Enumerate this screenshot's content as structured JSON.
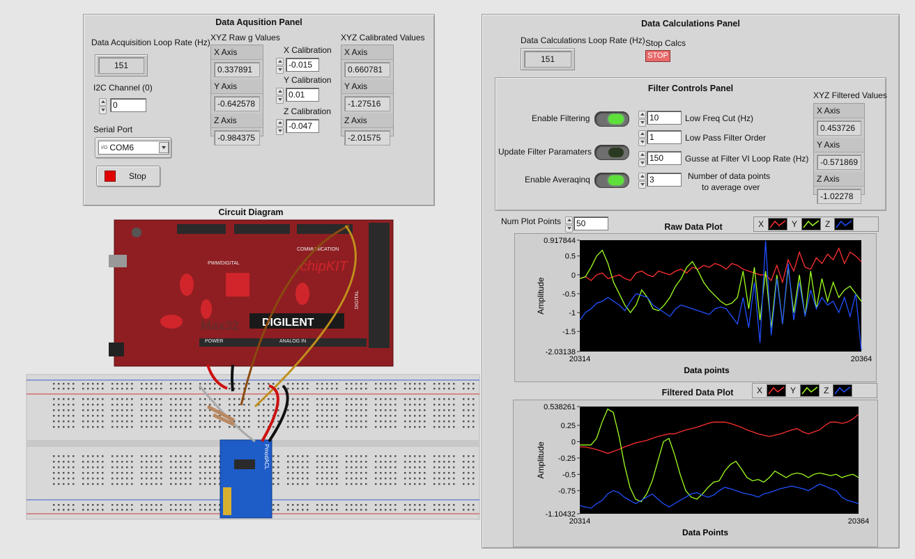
{
  "acq_panel": {
    "title": "Data Aqusition Panel",
    "loop_rate_label": "Data Acquisition Loop Rate (Hz)",
    "loop_rate_value": "151",
    "i2c_label": "I2C Channel (0)",
    "i2c_value": "0",
    "serial_label": "Serial Port",
    "serial_value": "COM6",
    "serial_io_glyph": "I/O",
    "stop_label": "Stop",
    "raw_title": "XYZ Raw g Values",
    "raw": [
      {
        "axis": "X Axis",
        "value": "0.337891"
      },
      {
        "axis": "Y Axis",
        "value": "-0.642578"
      },
      {
        "axis": "Z Axis",
        "value": "-0.984375"
      }
    ],
    "calibration": [
      {
        "label": "X Calibration",
        "value": "-0.015"
      },
      {
        "label": "Y Calibration",
        "value": "0.01"
      },
      {
        "label": "Z Calibration",
        "value": "-0.047"
      }
    ],
    "cal_title": "XYZ Calibrated Values",
    "calibrated": [
      {
        "axis": "X Axis",
        "value": "0.660781"
      },
      {
        "axis": "Y Axis",
        "value": "-1.27516"
      },
      {
        "axis": "Z Axis",
        "value": "-2.01575"
      }
    ]
  },
  "circuit": {
    "title": "Circuit Diagram",
    "board_text_chipkit": "chipKIT",
    "board_text_max32": "Max32",
    "board_text_digilent": "DIGILENT",
    "board_text_power": "POWER",
    "board_text_analog": "ANALOG IN",
    "board_text_pwm": "PWM/DIGITAL",
    "board_text_comm": "COMMUNICATION",
    "board_text_digital": "DIGITAL",
    "pmod_label": "PmodACL"
  },
  "calc_panel": {
    "title": "Data Calculations Panel",
    "loop_rate_label": "Data Calculations Loop Rate (Hz)",
    "loop_rate_value": "151",
    "stop_calcs_label": "Stop Calcs",
    "stop_button": "STOP",
    "filter_panel": {
      "title": "Filter Controls Panel",
      "enable_filtering": "Enable Filtering",
      "update_params": "Update Filter Paramaters",
      "enable_averaging": "Enable Averaqinq",
      "low_freq_value": "10",
      "low_freq_label": "Low Freq Cut (Hz)",
      "order_value": "1",
      "order_label": "Low Pass Filter Order",
      "gusse_value": "150",
      "gusse_label": "Gusse at Filter VI Loop Rate (Hz)",
      "avg_value": "3",
      "avg_label_1": "Number of data points",
      "avg_label_2": "to average over",
      "filtered_title": "XYZ Filtered Values",
      "filtered": [
        {
          "axis": "X Axis",
          "value": "0.453726"
        },
        {
          "axis": "Y Axis",
          "value": "-0.571869"
        },
        {
          "axis": "Z Axis",
          "value": "-1.02278"
        }
      ]
    },
    "num_plot_points_label": "Num Plot Points",
    "num_plot_points_value": "50",
    "colors": {
      "x": "#ff3030",
      "y": "#a0ff20",
      "z": "#2050ff"
    }
  },
  "raw_plot": {
    "title": "Raw Data Plot",
    "legend": [
      "X",
      "Y",
      "Z"
    ],
    "ylabel": "Amplitude",
    "xlabel": "Data points",
    "x_min_label": "20314",
    "x_max_label": "20364",
    "ticks": [
      "0.917844",
      "0.5",
      "0",
      "-0.5",
      "-1",
      "-1.5",
      "-2.03138"
    ]
  },
  "filtered_plot": {
    "title": "Filtered Data Plot",
    "legend": [
      "X",
      "Y",
      "Z"
    ],
    "ylabel": "Amplitude",
    "xlabel": "Data Points",
    "x_min_label": "20314",
    "x_max_label": "20364",
    "ticks": [
      "0.538261",
      "0.25",
      "0",
      "-0.25",
      "-0.5",
      "-0.75",
      "-1.10432"
    ]
  },
  "chart_data": [
    {
      "type": "line",
      "title": "Raw Data Plot",
      "xlabel": "Data points",
      "ylabel": "Amplitude",
      "xlim": [
        20314,
        20364
      ],
      "ylim": [
        -2.03138,
        0.917844
      ],
      "x": [
        20314,
        20315,
        20316,
        20317,
        20318,
        20319,
        20320,
        20321,
        20322,
        20323,
        20324,
        20325,
        20326,
        20327,
        20328,
        20329,
        20330,
        20331,
        20332,
        20333,
        20334,
        20335,
        20336,
        20337,
        20338,
        20339,
        20340,
        20341,
        20342,
        20343,
        20344,
        20345,
        20346,
        20347,
        20348,
        20349,
        20350,
        20351,
        20352,
        20353,
        20354,
        20355,
        20356,
        20357,
        20358,
        20359,
        20360,
        20361,
        20362,
        20363,
        20364
      ],
      "series": [
        {
          "name": "X",
          "values": [
            -0.1,
            -0.05,
            -0.15,
            0.0,
            0.05,
            -0.1,
            -0.05,
            0.0,
            -0.1,
            -0.15,
            0.05,
            0.1,
            0.0,
            -0.05,
            0.1,
            0.05,
            0.0,
            0.1,
            0.15,
            0.05,
            0.2,
            0.15,
            0.25,
            0.2,
            0.3,
            0.25,
            0.15,
            0.3,
            0.25,
            0.15,
            0.1,
            0.05,
            0.0,
            0.0,
            -0.15,
            0.25,
            -0.2,
            0.4,
            0.1,
            0.6,
            0.2,
            0.15,
            0.45,
            0.3,
            0.55,
            0.4,
            0.7,
            0.3,
            0.6,
            0.5,
            0.35
          ]
        },
        {
          "name": "Y",
          "values": [
            -0.1,
            -0.05,
            0.2,
            0.5,
            0.65,
            0.3,
            -0.2,
            -0.5,
            -0.8,
            -1.0,
            -0.8,
            -0.4,
            -0.6,
            -0.9,
            -0.95,
            -0.8,
            -0.6,
            -0.3,
            -0.1,
            0.2,
            0.35,
            0.1,
            -0.2,
            -0.4,
            -0.55,
            -0.7,
            -0.8,
            -0.75,
            -0.6,
            0.1,
            -0.9,
            0.2,
            -1.2,
            0.1,
            -1.4,
            0.0,
            -1.3,
            0.2,
            -1.0,
            0.0,
            -1.1,
            0.1,
            -0.9,
            -0.1,
            -0.7,
            -0.2,
            -0.6,
            -0.4,
            -0.3,
            -0.5,
            -0.7
          ]
        },
        {
          "name": "Z",
          "values": [
            -1.2,
            -1.0,
            -0.9,
            -0.75,
            -0.7,
            -0.6,
            -0.7,
            -0.8,
            -0.95,
            -0.7,
            -0.5,
            -0.55,
            -0.6,
            -0.8,
            -0.9,
            -1.0,
            -1.1,
            -0.9,
            -0.8,
            -0.85,
            -0.9,
            -0.95,
            -1.0,
            -1.05,
            -0.9,
            -0.85,
            -0.9,
            -1.1,
            -1.3,
            -0.6,
            -1.4,
            -0.2,
            -1.8,
            0.9,
            -1.6,
            -0.1,
            -1.3,
            0.3,
            -1.2,
            -0.2,
            -1.1,
            -0.4,
            -0.9,
            -0.6,
            -0.8,
            -0.7,
            -1.0,
            -0.6,
            -1.1,
            -0.5,
            -2.0
          ]
        }
      ]
    },
    {
      "type": "line",
      "title": "Filtered Data Plot",
      "xlabel": "Data Points",
      "ylabel": "Amplitude",
      "xlim": [
        20314,
        20364
      ],
      "ylim": [
        -1.10432,
        0.538261
      ],
      "x": [
        20314,
        20315,
        20316,
        20317,
        20318,
        20319,
        20320,
        20321,
        20322,
        20323,
        20324,
        20325,
        20326,
        20327,
        20328,
        20329,
        20330,
        20331,
        20332,
        20333,
        20334,
        20335,
        20336,
        20337,
        20338,
        20339,
        20340,
        20341,
        20342,
        20343,
        20344,
        20345,
        20346,
        20347,
        20348,
        20349,
        20350,
        20351,
        20352,
        20353,
        20354,
        20355,
        20356,
        20357,
        20358,
        20359,
        20360,
        20361,
        20362,
        20363,
        20364
      ],
      "series": [
        {
          "name": "X",
          "values": [
            -0.08,
            -0.08,
            -0.1,
            -0.12,
            -0.15,
            -0.18,
            -0.15,
            -0.12,
            -0.08,
            -0.05,
            -0.02,
            0.0,
            0.02,
            0.05,
            0.08,
            0.1,
            0.12,
            0.12,
            0.15,
            0.18,
            0.2,
            0.22,
            0.25,
            0.28,
            0.3,
            0.3,
            0.3,
            0.28,
            0.25,
            0.22,
            0.18,
            0.15,
            0.12,
            0.1,
            0.08,
            0.1,
            0.12,
            0.15,
            0.18,
            0.2,
            0.15,
            0.12,
            0.15,
            0.18,
            0.25,
            0.3,
            0.3,
            0.28,
            0.3,
            0.35,
            0.42
          ]
        },
        {
          "name": "Y",
          "values": [
            -0.05,
            -0.05,
            -0.05,
            0.05,
            0.3,
            0.5,
            0.45,
            0.1,
            -0.35,
            -0.7,
            -0.88,
            -0.92,
            -0.8,
            -0.6,
            -0.3,
            0.0,
            0.05,
            -0.2,
            -0.5,
            -0.75,
            -0.85,
            -0.88,
            -0.8,
            -0.7,
            -0.62,
            -0.6,
            -0.45,
            -0.35,
            -0.3,
            -0.42,
            -0.55,
            -0.6,
            -0.58,
            -0.62,
            -0.55,
            -0.45,
            -0.5,
            -0.55,
            -0.5,
            -0.48,
            -0.5,
            -0.55,
            -0.5,
            -0.48,
            -0.5,
            -0.52,
            -0.5,
            -0.55,
            -0.52,
            -0.5,
            -0.55
          ]
        },
        {
          "name": "Z",
          "values": [
            -0.98,
            -1.0,
            -1.02,
            -0.95,
            -0.9,
            -0.8,
            -0.75,
            -0.78,
            -0.85,
            -0.9,
            -0.95,
            -0.9,
            -0.85,
            -0.8,
            -0.88,
            -0.95,
            -1.0,
            -0.95,
            -0.9,
            -0.85,
            -0.8,
            -0.78,
            -0.82,
            -0.85,
            -0.82,
            -0.75,
            -0.7,
            -0.72,
            -0.75,
            -0.78,
            -0.8,
            -0.82,
            -0.85,
            -0.8,
            -0.78,
            -0.75,
            -0.72,
            -0.7,
            -0.68,
            -0.7,
            -0.72,
            -0.75,
            -0.7,
            -0.65,
            -0.68,
            -0.72,
            -0.75,
            -0.85,
            -0.9,
            -0.92,
            -0.95
          ]
        }
      ]
    }
  ]
}
